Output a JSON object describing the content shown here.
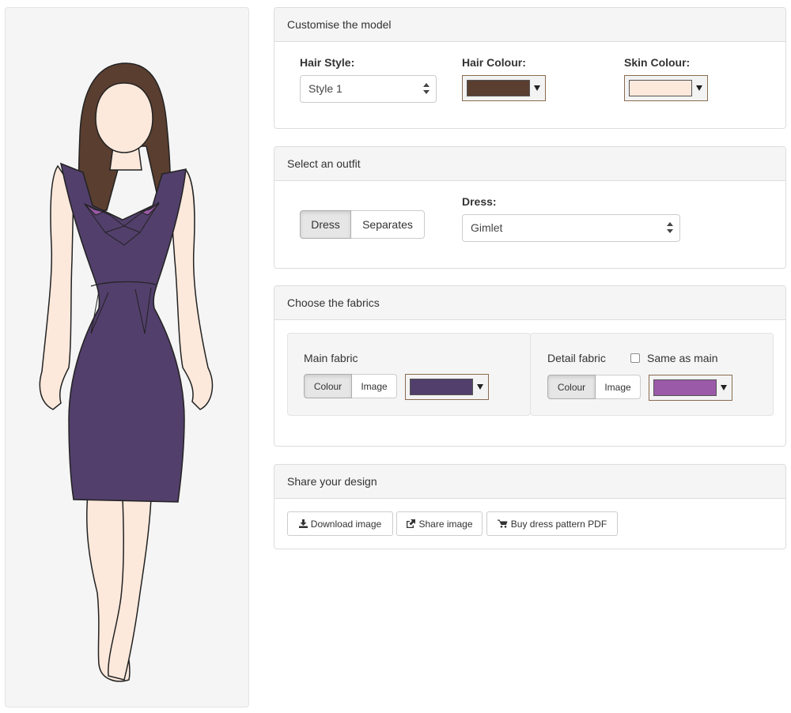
{
  "panels": {
    "model": {
      "title": "Customise the model",
      "hair_style_label": "Hair Style:",
      "hair_style_value": "Style 1",
      "hair_colour_label": "Hair Colour:",
      "hair_colour": "#5a3e30",
      "skin_colour_label": "Skin Colour:",
      "skin_colour": "#fde9dc"
    },
    "outfit": {
      "title": "Select an outfit",
      "tabs": [
        "Dress",
        "Separates"
      ],
      "active_tab": "Dress",
      "dress_label": "Dress:",
      "dress_value": "Gimlet"
    },
    "fabrics": {
      "title": "Choose the fabrics",
      "main": {
        "title": "Main fabric",
        "tabs": [
          "Colour",
          "Image"
        ],
        "active_tab": "Colour",
        "colour": "#523f6b"
      },
      "detail": {
        "title": "Detail fabric",
        "same_as_main_label": "Same as main",
        "same_as_main_checked": false,
        "tabs": [
          "Colour",
          "Image"
        ],
        "active_tab": "Colour",
        "colour": "#9b5aa8"
      }
    },
    "share": {
      "title": "Share your design",
      "download_label": "Download image",
      "share_label": "Share image",
      "buy_label": "Buy dress pattern PDF"
    }
  },
  "figure": {
    "hair_colour": "#5a3e30",
    "skin_colour": "#fde9dc",
    "dress_colour": "#523f6b",
    "detail_colour": "#9b5aa8"
  }
}
